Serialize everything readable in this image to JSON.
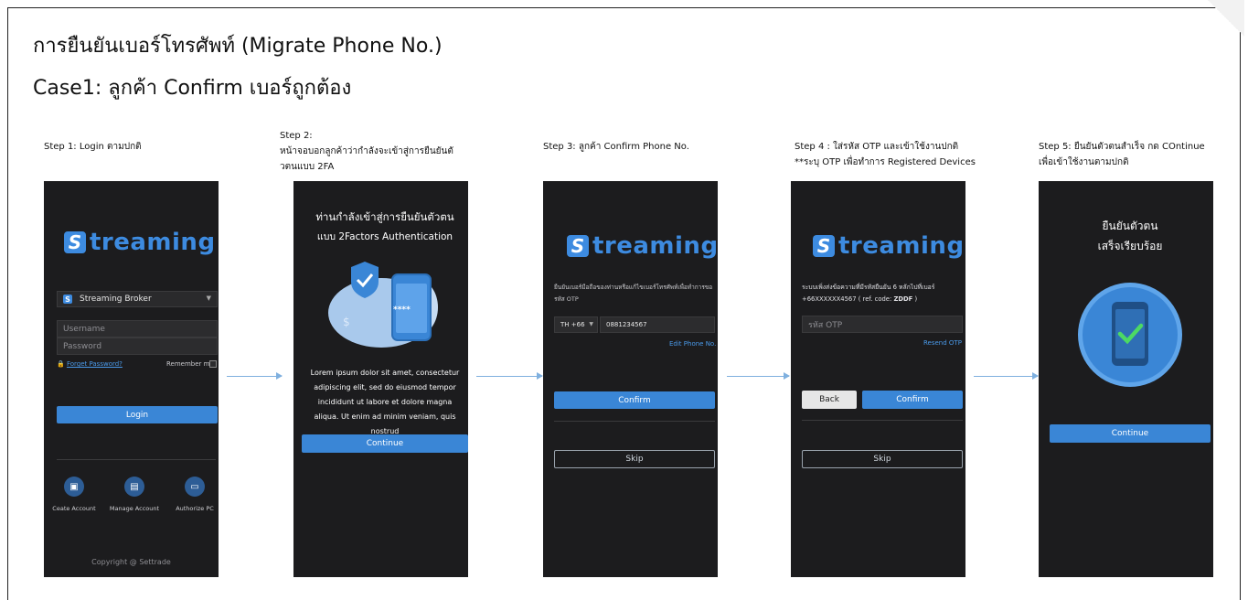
{
  "title": "การยืนยันเบอร์โทรศัพท์ (Migrate Phone No.)",
  "subtitle": "Case1: ลูกค้า Confirm เบอร์ถูกต้อง",
  "logo": {
    "mark": "S",
    "text": "treaming"
  },
  "step1": {
    "label": "Step 1: Login ตามปกติ",
    "broker": "Streaming Broker",
    "username_placeholder": "Username",
    "password_placeholder": "Password",
    "forgot": "Forget Password?",
    "remember": "Remember me",
    "login": "Login",
    "icons": [
      {
        "label": "Ceate Account",
        "icon": "user-card-icon"
      },
      {
        "label": "Manage Account",
        "icon": "document-icon"
      },
      {
        "label": "Authorize PC",
        "icon": "monitor-icon"
      }
    ],
    "copyright": "Copyright @ Settrade"
  },
  "step2": {
    "label_line1": "Step 2:",
    "label_line2": "หน้าจอบอกลูกค้าว่ากำลังจะเข้าสู่การยืนยันตั",
    "label_line3": "วตนแบบ 2FA",
    "heading_line1": "ท่านกำลังเข้าสู่การยืนยันตัวตน",
    "heading_line2": "แบบ 2Factors Authentication",
    "pin_mask": "****",
    "body": "Lorem ipsum dolor sit amet, consectetur adipiscing elit, sed do eiusmod tempor incididunt ut labore et dolore magna aliqua. Ut enim ad minim veniam, quis nostrud",
    "continue": "Continue"
  },
  "step3": {
    "label": "Step 3: ลูกค้า Confirm Phone No.",
    "description": "ยืนยันเบอร์มือถือของท่านหรือแก้ไขเบอร์โทรศัพท์เพื่อทำการขอรหัส OTP",
    "country_code": "TH +66",
    "phone": "0881234567",
    "edit_phone": "Edit Phone No.",
    "confirm": "Confirm",
    "skip": "Skip"
  },
  "step4": {
    "label_line1": "Step 4 : ใส่รหัส OTP และเข้าใช้งานปกติ",
    "label_line2": "**ระบุ OTP เพื่อทำการ Registered Devices",
    "message_line1": "ระบบเพิ่งส่งข้อความที่มีรหัสยืนยัน 6 หลักไปที่เบอร์",
    "message_line2_prefix": "+66XXXXXX4567 ( ref. code: ",
    "ref_code": "ZDDF",
    "message_line2_suffix": " )",
    "otp_placeholder": "รหัส OTP",
    "resend": "Resend OTP",
    "back": "Back",
    "confirm": "Confirm",
    "skip": "Skip"
  },
  "step5": {
    "label_line1": "Step 5: ยืนยันตัวตนสำเร็จ กด COntinue",
    "label_line2": "เพื่อเข้าใช้งานตามปกติ",
    "heading_line1": "ยืนยันตัวตน",
    "heading_line2": "เสร็จเรียบร้อย",
    "continue": "Continue"
  },
  "colors": {
    "accent": "#3a86d6",
    "phone_bg": "#1c1c1e",
    "arrow": "#7fb0df"
  }
}
